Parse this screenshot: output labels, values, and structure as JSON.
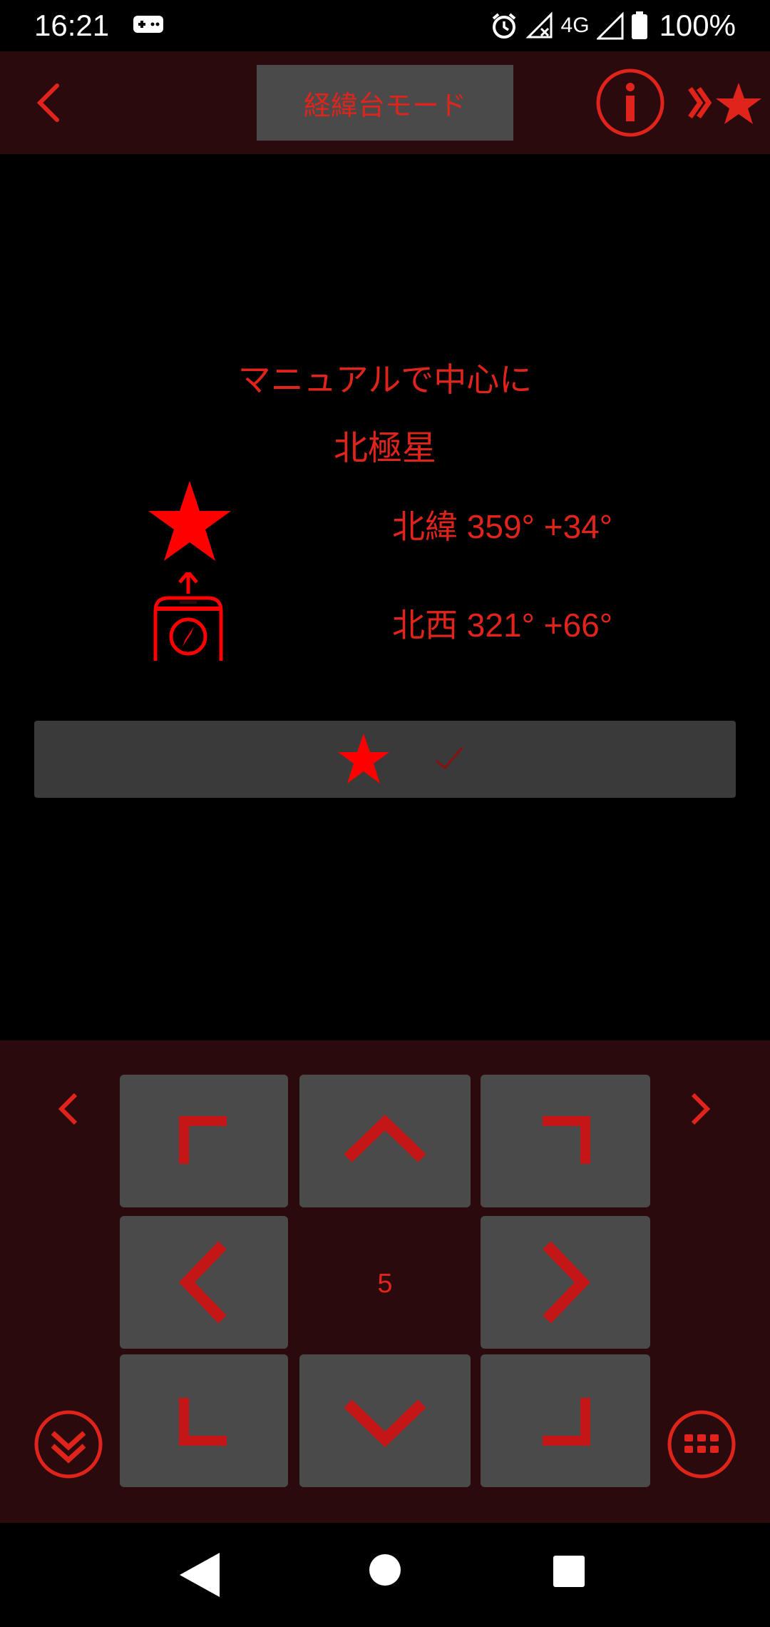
{
  "status": {
    "time": "16:21",
    "network": "4G",
    "battery": "100%"
  },
  "header": {
    "mode_label": "経緯台モード"
  },
  "main": {
    "instruction": "マニュアルで中心に",
    "target": "北極星",
    "star_coords": "北緯 359° +34°",
    "phone_coords": "北西 321° +66°"
  },
  "pad": {
    "step": "5"
  },
  "colors": {
    "accent": "#e0241c",
    "button_bg": "#4a4a4a",
    "panel_bg": "#2a0a0c"
  }
}
